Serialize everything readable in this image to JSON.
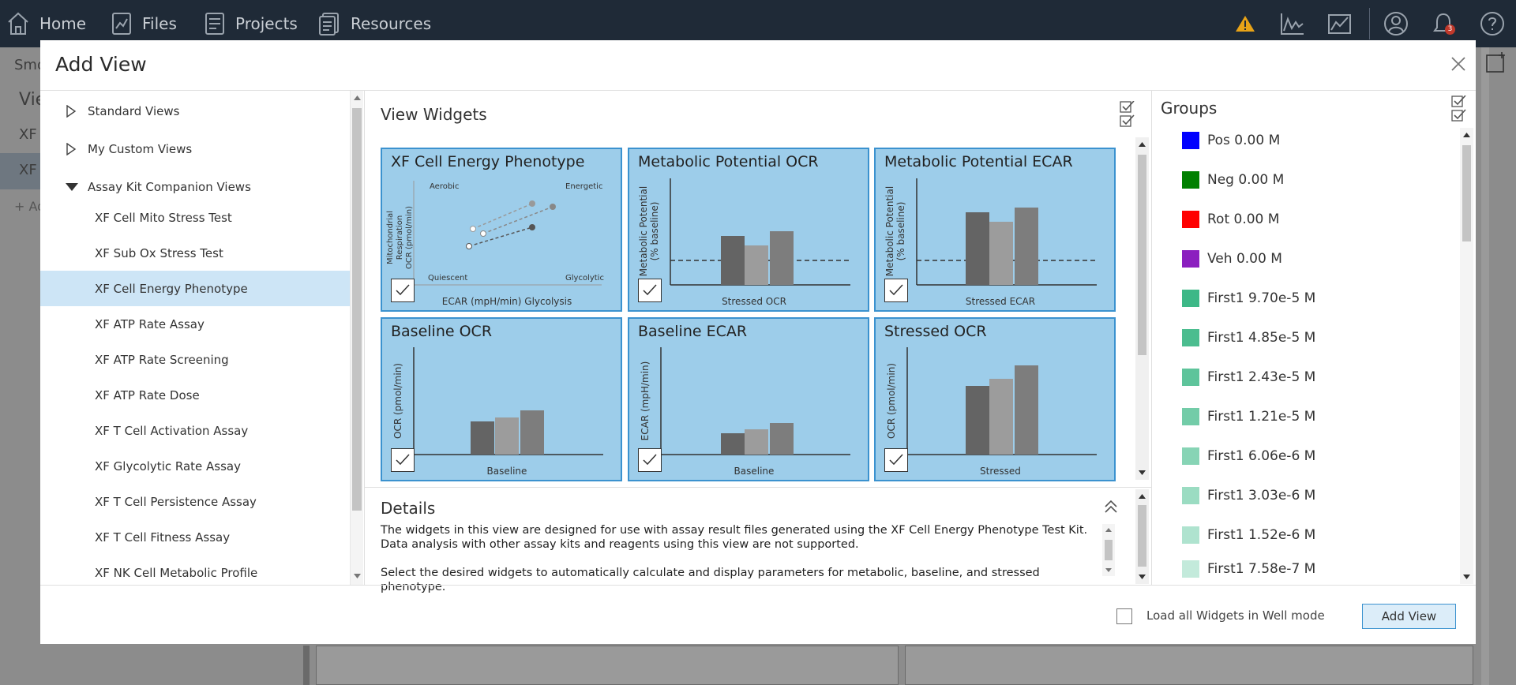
{
  "topnav": {
    "home": "Home",
    "files": "Files",
    "projects": "Projects",
    "resources": "Resources",
    "notification_count": "3"
  },
  "background": {
    "left_text_1": "Smo",
    "left_text_2": "Vie",
    "left_text_3": "XF C",
    "left_text_4": "XF A",
    "add_text": "+ Ad"
  },
  "dialog": {
    "title": "Add View"
  },
  "tree": {
    "groups": [
      {
        "label": "Standard Views"
      },
      {
        "label": "My Custom Views"
      },
      {
        "label": "Assay Kit Companion Views"
      }
    ],
    "items": [
      {
        "label": "XF Cell Mito Stress Test"
      },
      {
        "label": "XF Sub Ox Stress Test"
      },
      {
        "label": "XF Cell Energy Phenotype"
      },
      {
        "label": "XF ATP Rate Assay"
      },
      {
        "label": "XF ATP Rate Screening"
      },
      {
        "label": "XF ATP Rate Dose"
      },
      {
        "label": "XF T Cell Activation Assay"
      },
      {
        "label": "XF Glycolytic Rate Assay"
      },
      {
        "label": "XF T Cell Persistence Assay"
      },
      {
        "label": "XF T Cell Fitness Assay"
      },
      {
        "label": "XF NK Cell Metabolic Profile"
      }
    ]
  },
  "widgets": {
    "title": "View Widgets",
    "cards": [
      {
        "title": "XF Cell Energy Phenotype",
        "xlabel": "ECAR (mpH/min) Glycolysis",
        "ylabel1": "Mitochondrial",
        "ylabel2": "Respiration",
        "ylabel3": "OCR (pmol/min)",
        "q_tl": "Aerobic",
        "q_tr": "Energetic",
        "q_bl": "Quiescent",
        "q_br": "Glycolytic"
      },
      {
        "title": "Metabolic Potential OCR",
        "xlabel": "Stressed OCR",
        "ylabel1": "Metabolic Potential",
        "ylabel2": "(% baseline)"
      },
      {
        "title": "Metabolic Potential ECAR",
        "xlabel": "Stressed ECAR",
        "ylabel1": "Metabolic Potential",
        "ylabel2": "(% baseline)"
      },
      {
        "title": "Baseline OCR",
        "xlabel": "Baseline",
        "ylabel1": "OCR (pmol/min)"
      },
      {
        "title": "Baseline ECAR",
        "xlabel": "Baseline",
        "ylabel1": "ECAR (mpH/min)"
      },
      {
        "title": "Stressed OCR",
        "xlabel": "Stressed",
        "ylabel1": "OCR (pmol/min)"
      }
    ]
  },
  "details": {
    "title": "Details",
    "para1": "The widgets in this view are designed for use with assay result files generated using the XF Cell Energy Phenotype Test Kit. Data analysis with other assay kits and reagents using this view are not supported.",
    "para2": "Select the desired widgets to automatically calculate and display parameters for metabolic, baseline, and stressed phenotype."
  },
  "groups": {
    "title": "Groups",
    "items": [
      {
        "label": "Pos 0.00 M",
        "color": "#0000ff"
      },
      {
        "label": "Neg 0.00 M",
        "color": "#008000"
      },
      {
        "label": "Rot 0.00 M",
        "color": "#ff0000"
      },
      {
        "label": "Veh 0.00 M",
        "color": "#8b1fbf"
      },
      {
        "label": "First1 9.70e-5 M",
        "color": "#3db887"
      },
      {
        "label": "First1 4.85e-5 M",
        "color": "#4bbd8f"
      },
      {
        "label": "First1 2.43e-5 M",
        "color": "#5ec49b"
      },
      {
        "label": "First1 1.21e-5 M",
        "color": "#73cca8"
      },
      {
        "label": "First1 6.06e-6 M",
        "color": "#87d4b5"
      },
      {
        "label": "First1 3.03e-6 M",
        "color": "#9bdcc2"
      },
      {
        "label": "First1 1.52e-6 M",
        "color": "#afe3cf"
      },
      {
        "label": "First1 7.58e-7 M",
        "color": "#c3eadb"
      }
    ]
  },
  "footer": {
    "load_label": "Load all Widgets in Well mode",
    "add_button": "Add View"
  },
  "colors": {
    "accent": "#3b92cf",
    "card_bg": "#9dcdea",
    "selection": "#cde5f6",
    "topbar": "#1f2a37"
  }
}
